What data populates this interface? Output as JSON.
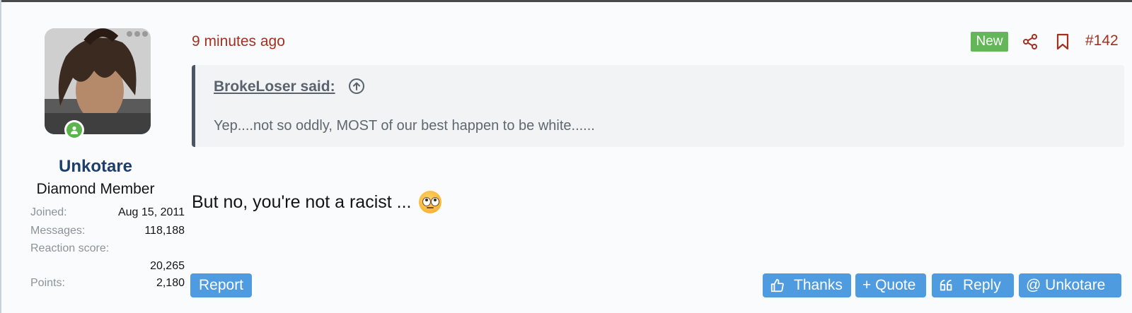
{
  "post": {
    "time": "9 minutes ago",
    "badge": "New",
    "number": "#142",
    "quote": {
      "author": "BrokeLoser said:",
      "text": "Yep....not so oddly, MOST of our best happen to be white......"
    },
    "body": "But no, you're not a racist ...",
    "emoji": "face-with-rolling-eyes"
  },
  "user": {
    "name": "Unkotare",
    "title": "Diamond Member",
    "stats": {
      "joined_label": "Joined:",
      "joined_value": "Aug 15, 2011",
      "messages_label": "Messages:",
      "messages_value": "118,188",
      "score_label": "Reaction score:",
      "score_value": "20,265",
      "points_label": "Points:",
      "points_value": "2,180"
    }
  },
  "actions": {
    "report": "Report",
    "thanks": "Thanks",
    "quote": "+ Quote",
    "reply": "Reply",
    "mention": "@ Unkotare"
  },
  "colors": {
    "accent": "#a3311f",
    "button": "#4e9be0",
    "badge": "#63b758",
    "username": "#1f3d6b"
  }
}
